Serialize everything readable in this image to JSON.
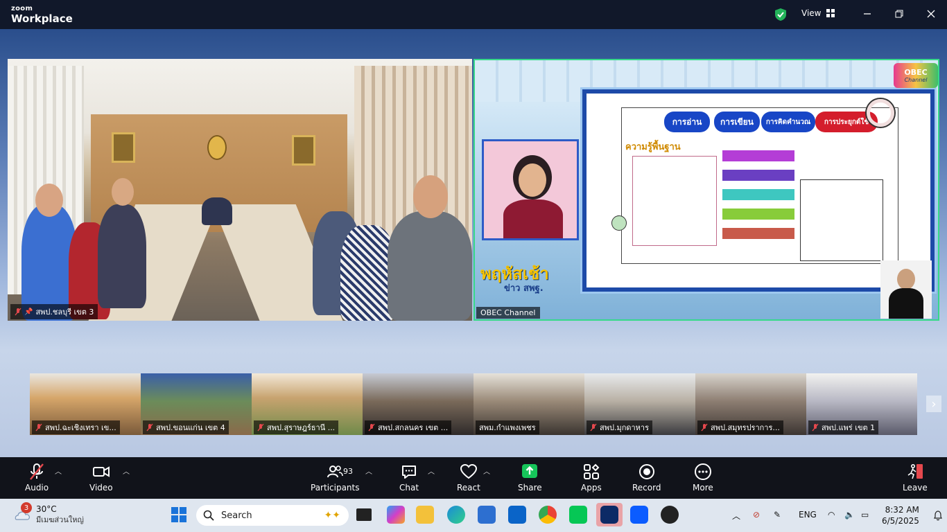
{
  "window": {
    "brand_top": "zoom",
    "brand_bottom": "Workplace",
    "view_label": "View"
  },
  "main_video": {
    "name": "สพป.ชลบุรี เขต 3"
  },
  "share": {
    "name": "OBEC Channel",
    "logo": "OBEC",
    "logo_sub": "Channel",
    "show_title": "พฤหัสเช้า",
    "show_sub": "ข่าว สพฐ.",
    "slide": {
      "tabs": [
        "การอ่าน",
        "การเขียน",
        "การคิดคำนวณ",
        "การประยุกต์ใช้"
      ],
      "heading": "ความรู้พื้นฐาน"
    }
  },
  "strip": [
    {
      "name": "สพป.ฉะเชิงเทรา เข..."
    },
    {
      "name": "สพป.ขอนแก่น เขต 4"
    },
    {
      "name": "สพป.สุราษฎร์ธานี ..."
    },
    {
      "name": "สพป.สกลนคร เขต ..."
    },
    {
      "name": "สพม.กำแพงเพชร"
    },
    {
      "name": "สพป.มุกดาหาร"
    },
    {
      "name": "สพป.สมุทรปราการ..."
    },
    {
      "name": "สพป.แพร่ เขต 1"
    }
  ],
  "toolbar": {
    "audio": "Audio",
    "video": "Video",
    "participants": "Participants",
    "participants_count": "93",
    "chat": "Chat",
    "react": "React",
    "share": "Share",
    "apps": "Apps",
    "record": "Record",
    "more": "More",
    "leave": "Leave"
  },
  "taskbar": {
    "weather_temp": "30°C",
    "weather_desc": "มีเมฆส่วนใหญ่",
    "weather_badge": "3",
    "search_placeholder": "Search",
    "language": "ENG",
    "time": "8:32 AM",
    "date": "6/5/2025"
  },
  "colors": {
    "share_border": "#37d98a",
    "share_button": "#16c55a",
    "muted_red": "#e5484d"
  }
}
